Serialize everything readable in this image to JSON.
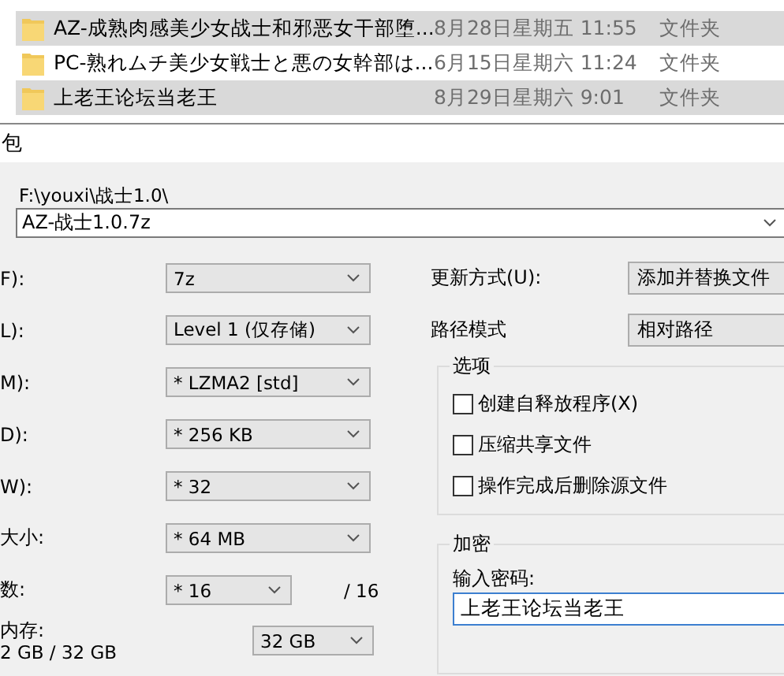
{
  "files": [
    {
      "name": "AZ-成熟肉感美少女战士和邪恶女干部堕...",
      "date": "8月28日星期五 11:55",
      "type": "文件夹",
      "selected": true
    },
    {
      "name": "PC-熟れムチ美少女戦士と悪の女幹部は...",
      "date": "6月15日星期六 11:24",
      "type": "文件夹",
      "selected": false
    },
    {
      "name": "上老王论坛当老王",
      "date": "8月29日星期六 9:01",
      "type": "文件夹",
      "selected": true
    }
  ],
  "dialog": {
    "title": "包",
    "archive_folder": "F:\\youxi\\战士1.0\\",
    "archive_name": "AZ-战士1.0.7z",
    "left_fields": [
      {
        "kind": "wide",
        "label": "F):",
        "value": "7z"
      },
      {
        "kind": "wide",
        "label": "L):",
        "value": "Level 1 (仅存储)"
      },
      {
        "kind": "wide",
        "label": "M):",
        "value": "* LZMA2 [std]"
      },
      {
        "kind": "wide",
        "label": "D):",
        "value": "* 256 KB"
      },
      {
        "kind": "wide",
        "label": "W):",
        "value": "* 32"
      },
      {
        "kind": "wide",
        "label": "大小:",
        "value": "* 64 MB"
      },
      {
        "kind": "narrow",
        "label": "数:",
        "value": "* 16",
        "suffix": "/ 16"
      },
      {
        "kind": "memory",
        "label": "内存:",
        "sublabel": "2 GB / 32 GB",
        "value": "32 GB"
      }
    ],
    "update_mode": {
      "label": "更新方式(U):",
      "value": "添加并替换文件"
    },
    "path_mode": {
      "label": "路径模式",
      "value": "相对路径"
    },
    "options": {
      "title": "选项",
      "items": [
        {
          "label": "创建自释放程序(X)",
          "checked": false
        },
        {
          "label": "压缩共享文件",
          "checked": false
        },
        {
          "label": "操作完成后删除源文件",
          "checked": false
        }
      ]
    },
    "encryption": {
      "title": "加密",
      "password_label": "输入密码:",
      "password_value": "上老王论坛当老王"
    }
  }
}
